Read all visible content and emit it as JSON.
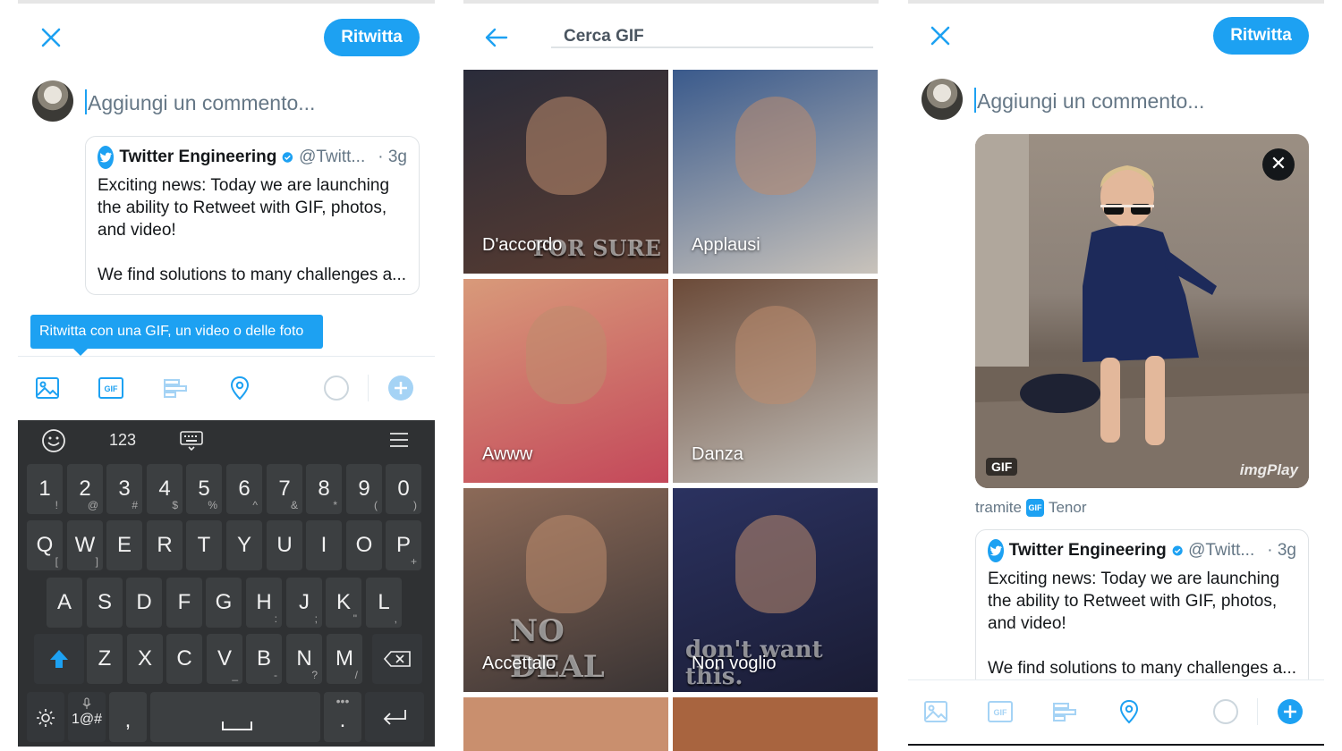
{
  "colors": {
    "accent": "#1da1f2",
    "keyboard_bg": "#2f3133",
    "muted": "#657786"
  },
  "compose": {
    "retweet_button": "Ritwitta",
    "comment_placeholder": "Aggiungi un commento...",
    "tooltip": "Ritwitta con una GIF, un video o delle foto"
  },
  "quoted_tweet": {
    "name": "Twitter Engineering",
    "handle": "@Twitt...",
    "time": "· 3g",
    "line1": "Exciting news: Today we are launching",
    "line2": "the ability to Retweet with GIF, photos,",
    "line3": "and video!",
    "line4": "We find solutions to many challenges a..."
  },
  "toolbar_icons": [
    "image-icon",
    "gif-icon",
    "poll-icon",
    "location-icon",
    "progress-circle-icon",
    "add-icon"
  ],
  "keyboard": {
    "top": {
      "numbers": "123"
    },
    "number_row": [
      {
        "m": "1",
        "s": "!"
      },
      {
        "m": "2",
        "s": "@"
      },
      {
        "m": "3",
        "s": "#"
      },
      {
        "m": "4",
        "s": "$"
      },
      {
        "m": "5",
        "s": "%"
      },
      {
        "m": "6",
        "s": "^"
      },
      {
        "m": "7",
        "s": "&"
      },
      {
        "m": "8",
        "s": "*"
      },
      {
        "m": "9",
        "s": "("
      },
      {
        "m": "0",
        "s": ")"
      }
    ],
    "row1": [
      {
        "m": "Q",
        "s": "["
      },
      {
        "m": "W",
        "s": "]"
      },
      {
        "m": "E",
        "s": ""
      },
      {
        "m": "R",
        "s": ""
      },
      {
        "m": "T",
        "s": ""
      },
      {
        "m": "Y",
        "s": ""
      },
      {
        "m": "U",
        "s": ""
      },
      {
        "m": "I",
        "s": ""
      },
      {
        "m": "O",
        "s": ""
      },
      {
        "m": "P",
        "s": "+"
      }
    ],
    "row2": [
      {
        "m": "A",
        "s": ""
      },
      {
        "m": "S",
        "s": ""
      },
      {
        "m": "D",
        "s": ""
      },
      {
        "m": "F",
        "s": ""
      },
      {
        "m": "G",
        "s": ""
      },
      {
        "m": "H",
        "s": ":"
      },
      {
        "m": "J",
        "s": ";"
      },
      {
        "m": "K",
        "s": "\""
      },
      {
        "m": "L",
        "s": ","
      }
    ],
    "row3": [
      {
        "m": "Z",
        "s": ""
      },
      {
        "m": "X",
        "s": ""
      },
      {
        "m": "C",
        "s": ""
      },
      {
        "m": "V",
        "s": "_"
      },
      {
        "m": "B",
        "s": "-"
      },
      {
        "m": "N",
        "s": "?"
      },
      {
        "m": "M",
        "s": "/"
      }
    ],
    "symbols_key": "1@#",
    "comma_key": ",",
    "period_key": "."
  },
  "gif_search": {
    "placeholder": "Cerca GIF",
    "tiles": [
      {
        "label": "D'accordo",
        "overlay": "FOR SURE",
        "color_a": "#2a2c3a",
        "color_b": "#5a3c30"
      },
      {
        "label": "Applausi",
        "overlay": "",
        "color_a": "#3a5a8c",
        "color_b": "#c9c3bb"
      },
      {
        "label": "Awww",
        "overlay": "",
        "color_a": "#d89a7a",
        "color_b": "#c4485a"
      },
      {
        "label": "Danza",
        "overlay": "",
        "color_a": "#6b4a38",
        "color_b": "#c2c0bb"
      },
      {
        "label": "Accettalo",
        "overlay": "NO DEAL",
        "color_a": "#8c6a58",
        "color_b": "#3a3434"
      },
      {
        "label": "Non voglio",
        "overlay": "don't want this.",
        "color_a": "#2b3260",
        "color_b": "#1a1c34"
      }
    ]
  },
  "attached_gif": {
    "badge": "GIF",
    "watermark": "imgPlay",
    "via_label": "tramite",
    "provider_logo": "GIF",
    "provider": "Tenor"
  }
}
